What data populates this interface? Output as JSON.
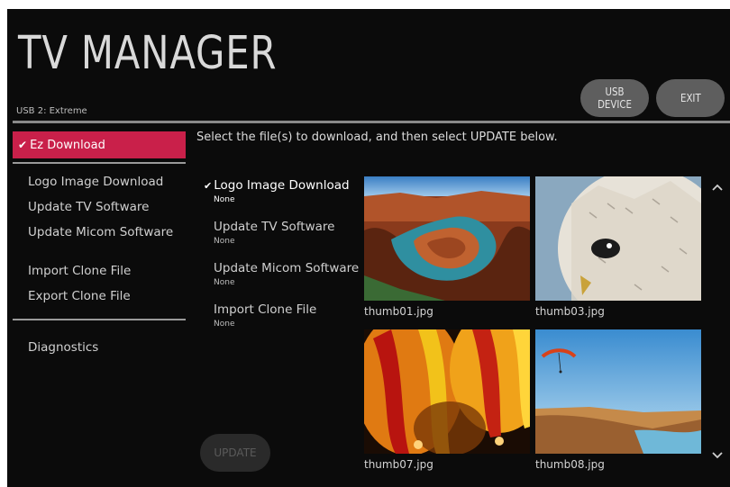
{
  "header": {
    "title": "TV MANAGER",
    "source": "USB 2: Extreme",
    "usb_device_label": "USB DEVICE",
    "exit_label": "EXIT"
  },
  "sidebar": {
    "active_label": "Ez Download",
    "group1": [
      "Logo Image Download",
      "Update TV Software",
      "Update Micom Software"
    ],
    "group2": [
      "Import Clone File",
      "Export Clone File"
    ],
    "group3": [
      "Diagnostics"
    ]
  },
  "main": {
    "instruction": "Select the file(s) to download, and then select UPDATE below.",
    "options": [
      {
        "name": "Logo Image Download",
        "value": "None",
        "selected": true
      },
      {
        "name": "Update TV Software",
        "value": "None",
        "selected": false
      },
      {
        "name": "Update Micom Software",
        "value": "None",
        "selected": false
      },
      {
        "name": "Import Clone File",
        "value": "None",
        "selected": false
      }
    ],
    "update_label": "UPDATE",
    "thumbnails": [
      {
        "file": "thumb01.jpg"
      },
      {
        "file": "thumb03.jpg"
      },
      {
        "file": "thumb07.jpg"
      },
      {
        "file": "thumb08.jpg"
      }
    ]
  },
  "colors": {
    "accent": "#c9204a",
    "background": "#0b0b0b",
    "button": "#5e5e5e"
  },
  "icons": {
    "check": "check-icon",
    "scroll_up": "chevron-up-icon",
    "scroll_down": "chevron-down-icon"
  }
}
